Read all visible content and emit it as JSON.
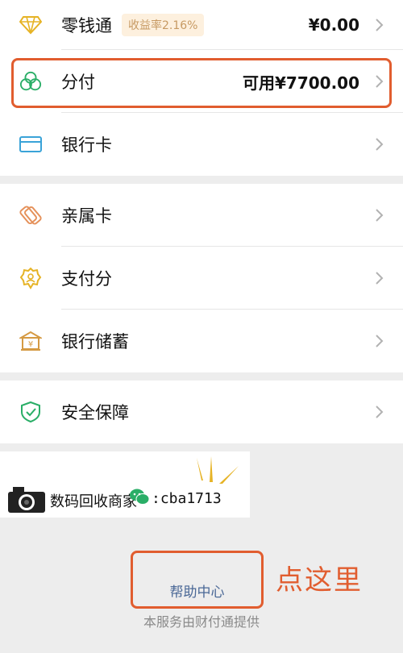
{
  "wallet": {
    "items": [
      {
        "label": "零钱通",
        "badge": "收益率2.16%",
        "value": "¥0.00",
        "icon": "diamond-icon"
      },
      {
        "label": "分付",
        "value": "可用¥7700.00",
        "icon": "fenfu-circles-icon"
      },
      {
        "label": "银行卡",
        "icon": "bank-card-icon"
      }
    ]
  },
  "services": {
    "items": [
      {
        "label": "亲属卡",
        "icon": "family-card-icon"
      },
      {
        "label": "支付分",
        "icon": "payscore-badge-icon"
      },
      {
        "label": "银行储蓄",
        "icon": "bank-savings-icon"
      }
    ]
  },
  "security": {
    "items": [
      {
        "label": "安全保障",
        "icon": "shield-icon"
      }
    ]
  },
  "watermark": {
    "text": "数码回收商家",
    "wechat_id": ":cba1713"
  },
  "footer": {
    "help_label": "帮助中心",
    "annotation": "点这里",
    "provider": "本服务由财付通提供"
  },
  "colors": {
    "highlight": "#e15d2f",
    "link": "#4a6896",
    "green": "#2aae67",
    "gold": "#e6b325"
  }
}
